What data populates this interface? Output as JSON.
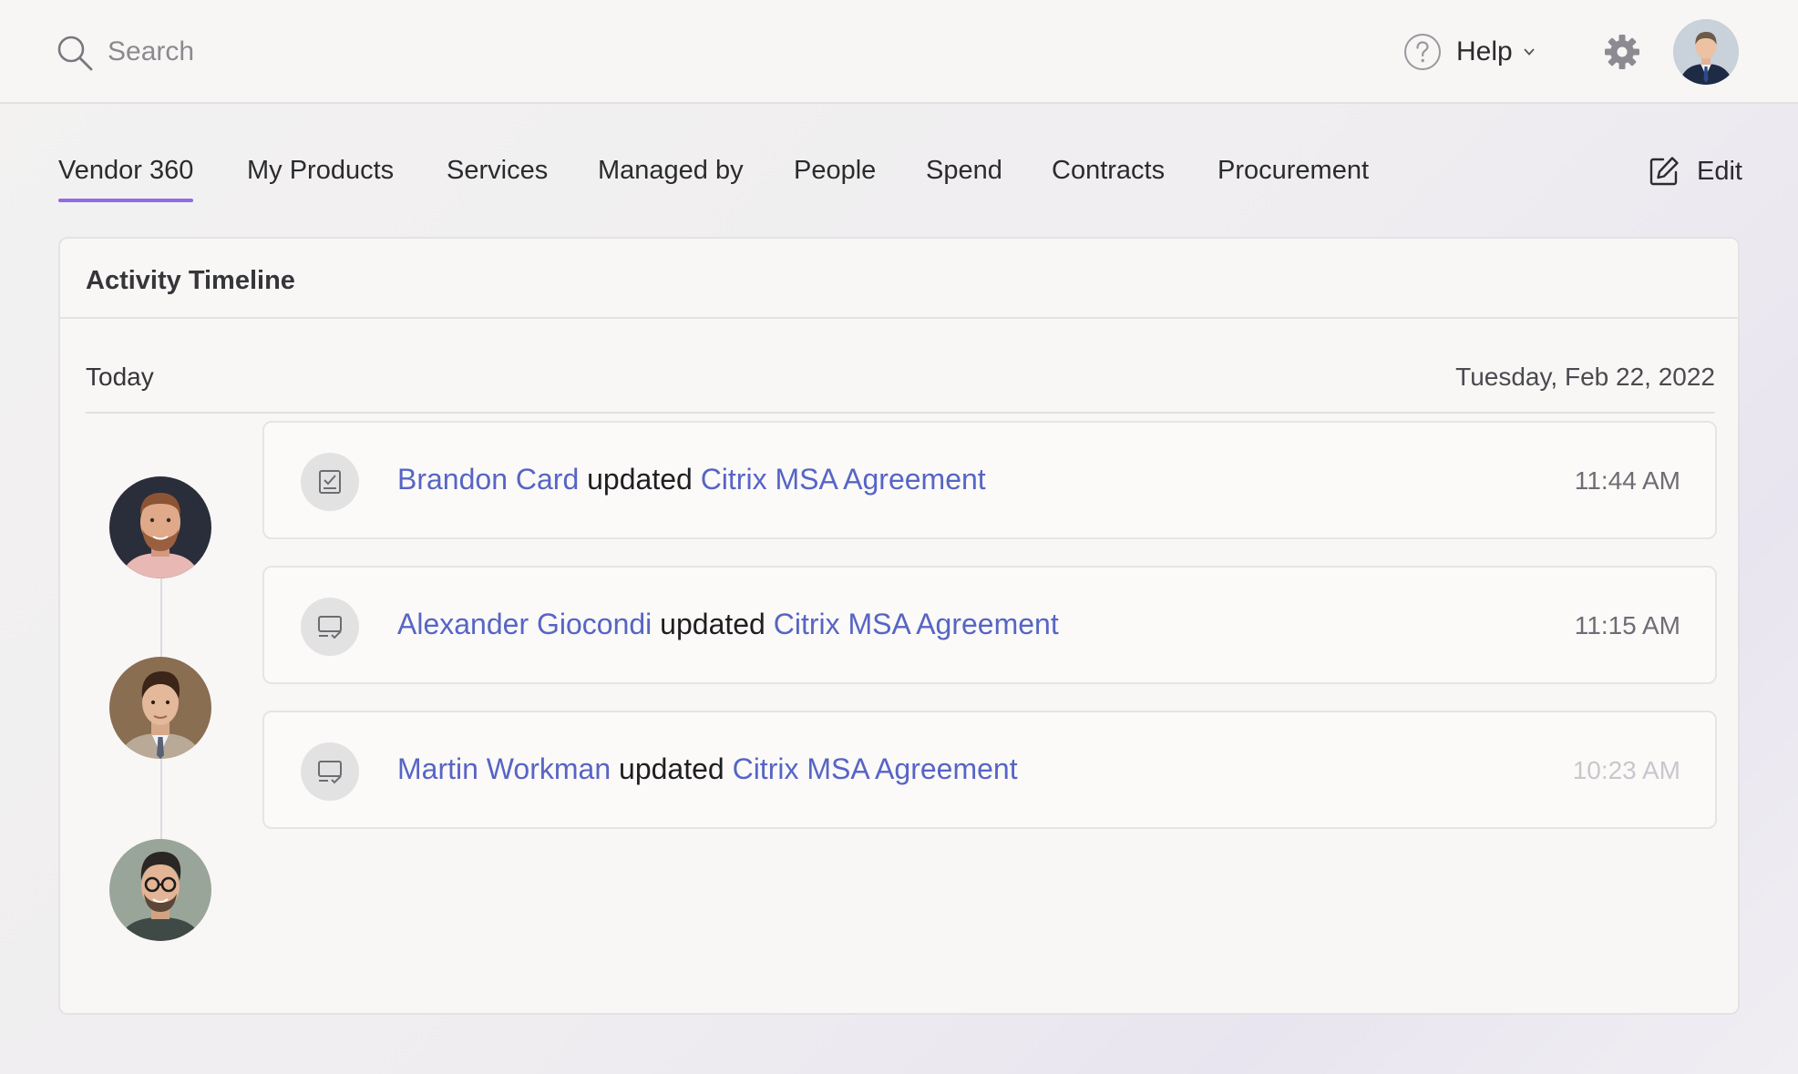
{
  "header": {
    "search_placeholder": "Search",
    "help_label": "Help"
  },
  "tabs": [
    {
      "label": "Vendor 360",
      "active": true
    },
    {
      "label": "My Products"
    },
    {
      "label": "Services"
    },
    {
      "label": "Managed by"
    },
    {
      "label": "People"
    },
    {
      "label": "Spend"
    },
    {
      "label": "Contracts"
    },
    {
      "label": "Procurement"
    }
  ],
  "edit_label": "Edit",
  "card": {
    "title": "Activity Timeline",
    "day_label": "Today",
    "day_date": "Tuesday, Feb 22, 2022"
  },
  "entries": [
    {
      "user": "Brandon Card",
      "verb": "updated",
      "target": "Citrix MSA Agreement",
      "time": "11:44 AM",
      "icon": "checklist-icon"
    },
    {
      "user": "Alexander Giocondi",
      "verb": "updated",
      "target": "Citrix MSA Agreement",
      "time": "11:15 AM",
      "icon": "screen-check-icon"
    },
    {
      "user": "Martin Workman",
      "verb": "updated",
      "target": "Citrix MSA Agreement",
      "time": "10:23 AM",
      "icon": "screen-check-icon"
    }
  ],
  "colors": {
    "accent": "#8e6ee0",
    "link": "#5765c4"
  }
}
